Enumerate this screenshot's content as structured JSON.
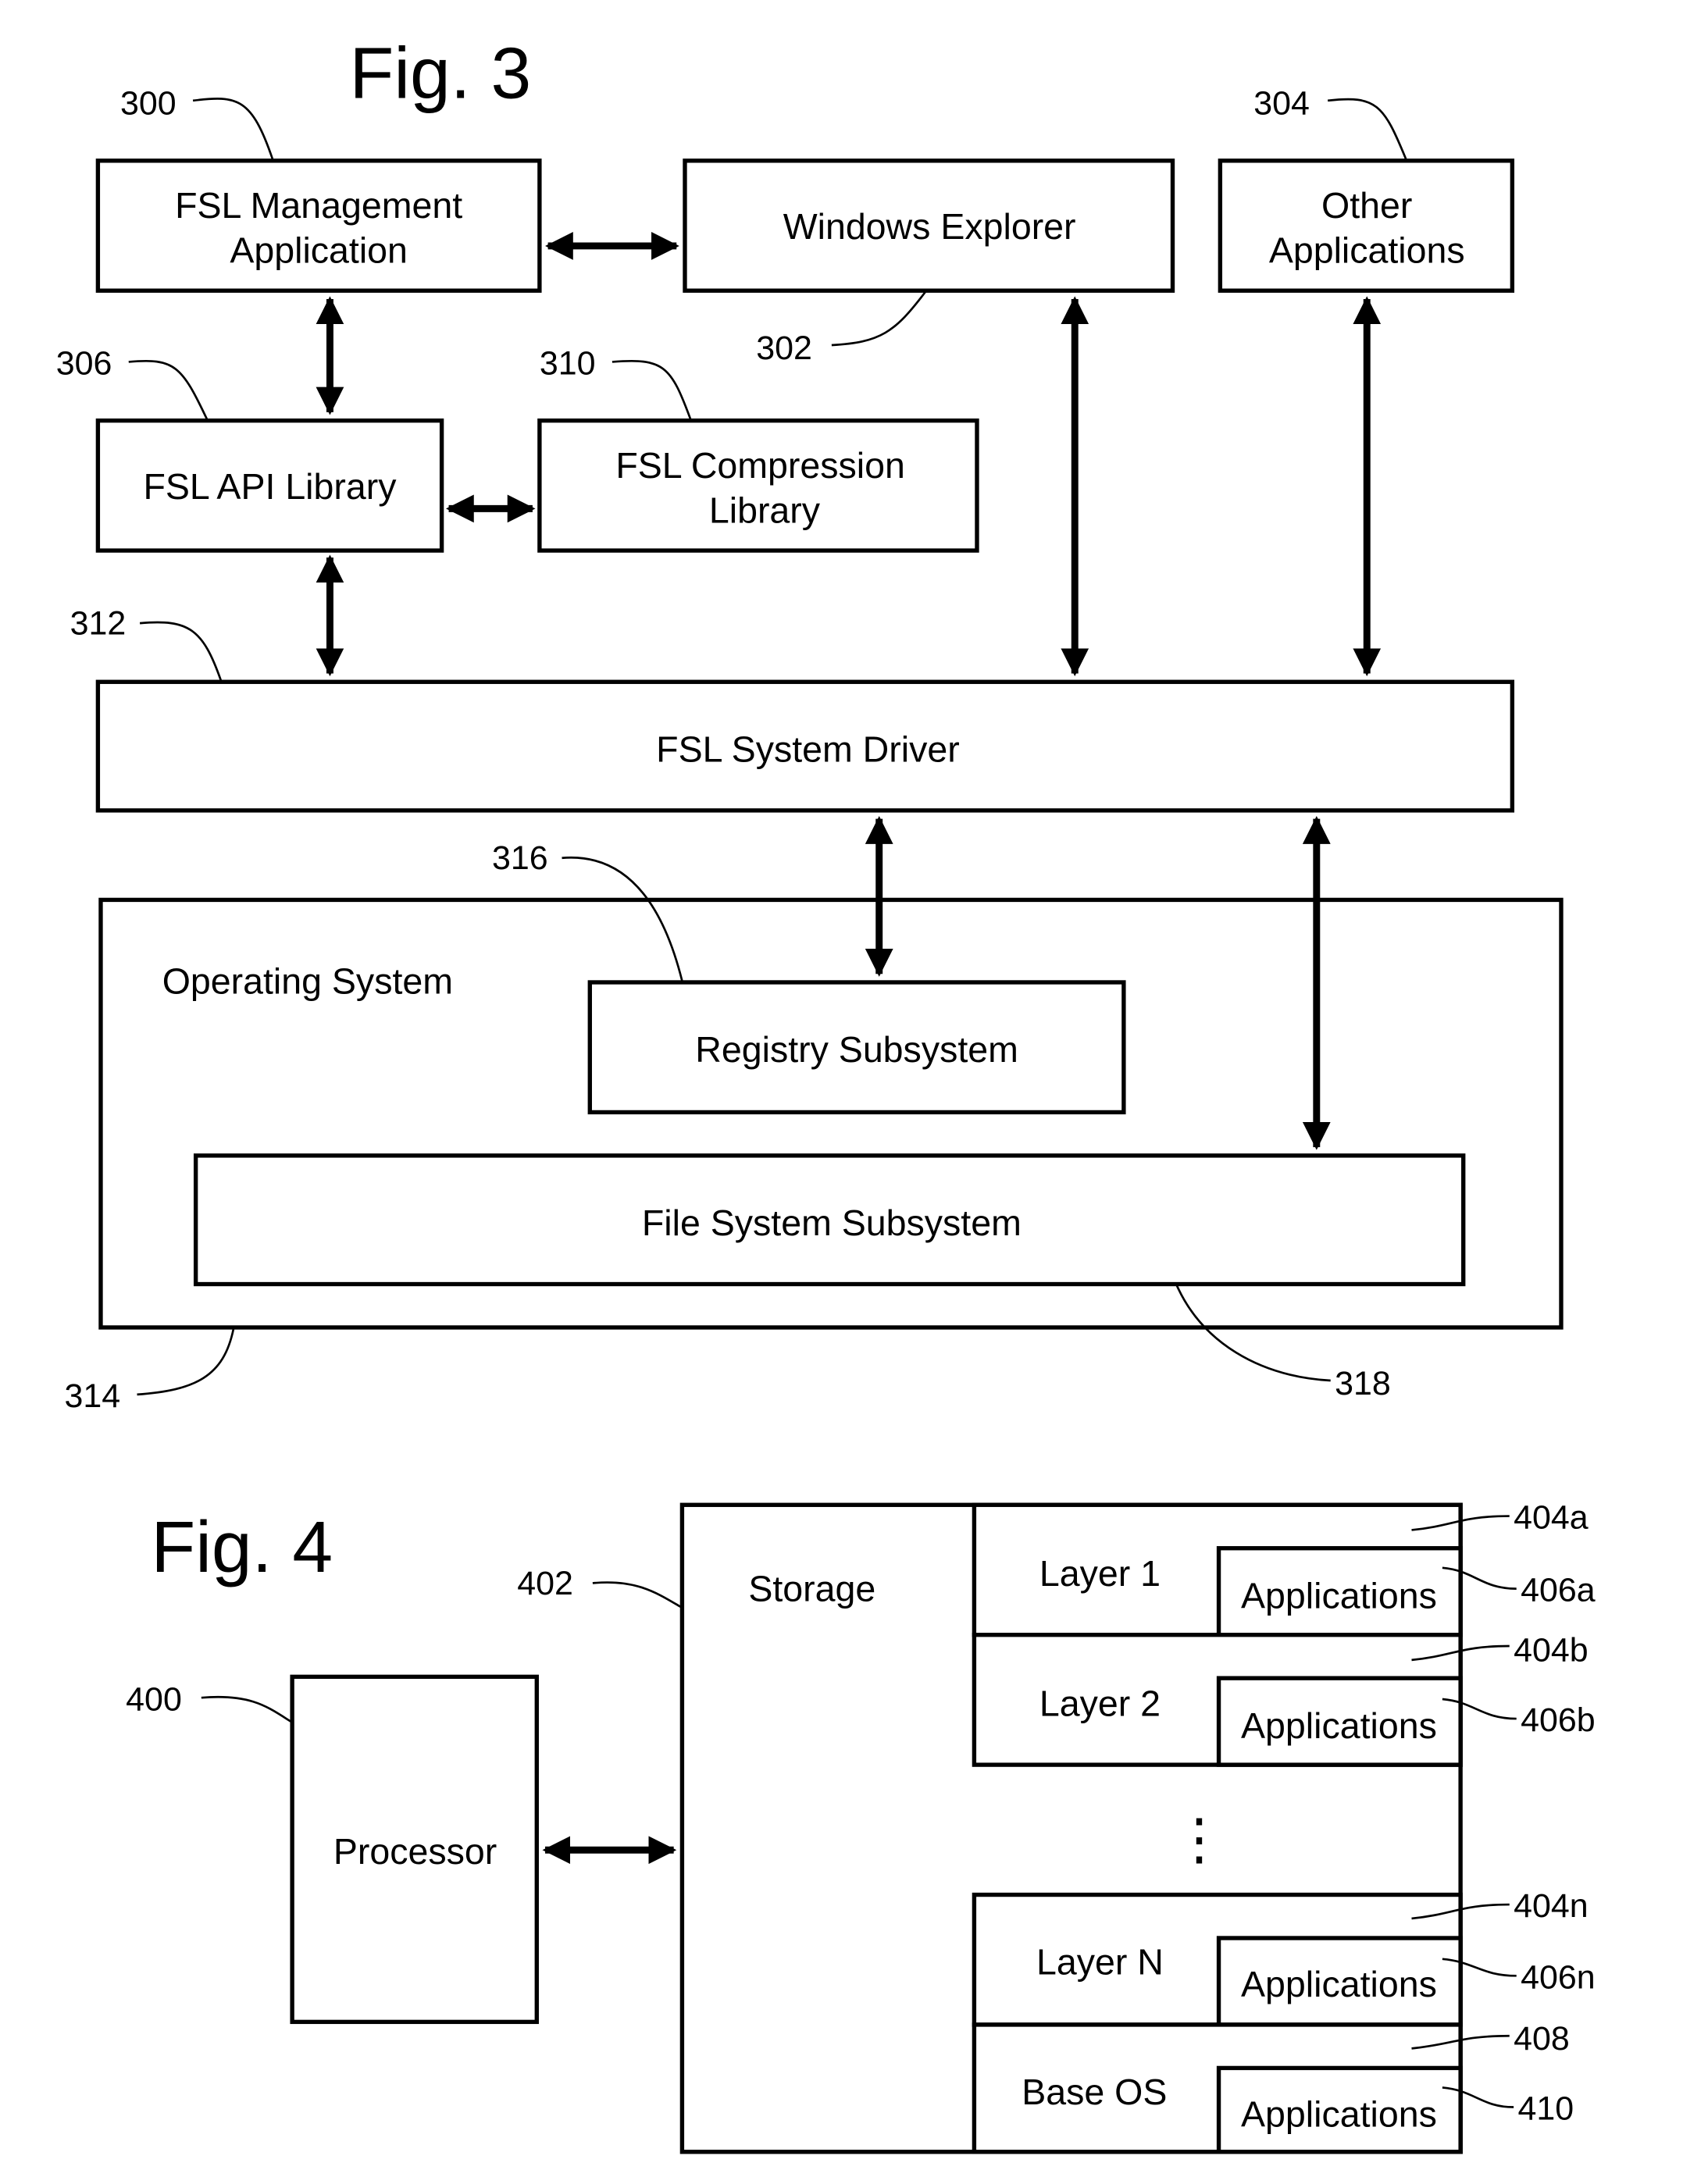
{
  "fig3": {
    "title": "Fig. 3",
    "boxes": {
      "fsl_management": {
        "line1": "FSL Management",
        "line2": "Application",
        "ref": "300"
      },
      "windows_explorer": {
        "label": "Windows Explorer",
        "ref": "302"
      },
      "other_applications": {
        "line1": "Other",
        "line2": "Applications",
        "ref": "304"
      },
      "fsl_api_library": {
        "label": "FSL API Library",
        "ref": "306"
      },
      "fsl_compression": {
        "line1": "FSL Compression",
        "line2": "Library",
        "ref": "310"
      },
      "fsl_system_driver": {
        "label": "FSL System Driver",
        "ref": "312"
      },
      "operating_system": {
        "label": "Operating System",
        "ref": "314"
      },
      "registry_subsystem": {
        "label": "Registry Subsystem",
        "ref": "316"
      },
      "file_system_subsystem": {
        "label": "File System Subsystem",
        "ref": "318"
      }
    }
  },
  "fig4": {
    "title": "Fig. 4",
    "processor": {
      "label": "Processor",
      "ref": "400"
    },
    "storage": {
      "label": "Storage",
      "ref": "402"
    },
    "layers": [
      {
        "label": "Layer 1",
        "ref": "404a",
        "apps_label": "Applications",
        "apps_ref": "406a"
      },
      {
        "label": "Layer 2",
        "ref": "404b",
        "apps_label": "Applications",
        "apps_ref": "406b"
      },
      {
        "label": "Layer N",
        "ref": "404n",
        "apps_label": "Applications",
        "apps_ref": "406n"
      },
      {
        "label": "Base OS",
        "ref": "408",
        "apps_label": "Applications",
        "apps_ref": "410"
      }
    ],
    "ellipsis": "⋮"
  }
}
